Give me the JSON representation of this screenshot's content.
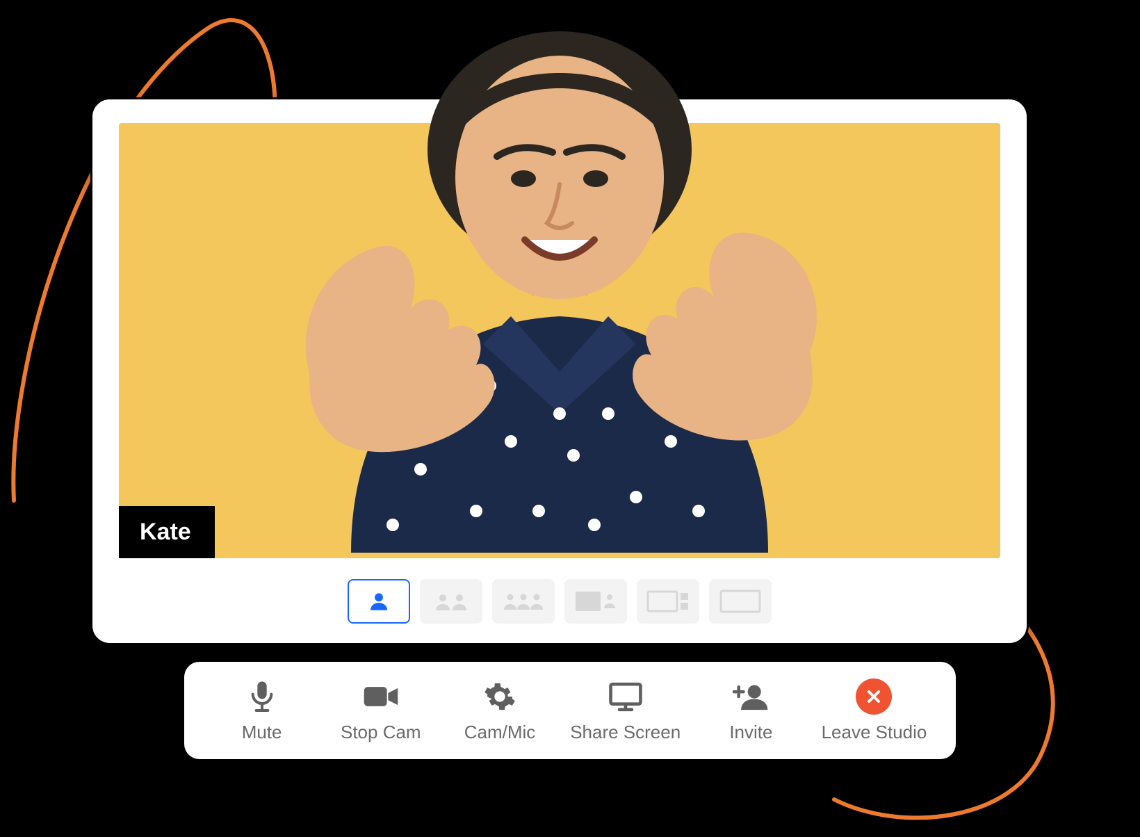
{
  "participant": {
    "name": "Kate"
  },
  "layouts": {
    "active_index": 0,
    "options": [
      {
        "name": "single"
      },
      {
        "name": "two-up"
      },
      {
        "name": "three-up"
      },
      {
        "name": "spotlight-right"
      },
      {
        "name": "spotlight-left"
      },
      {
        "name": "fullscreen"
      }
    ]
  },
  "toolbar": {
    "mute": {
      "label": "Mute",
      "icon": "microphone-icon"
    },
    "stop_cam": {
      "label": "Stop Cam",
      "icon": "video-icon"
    },
    "cam_mic": {
      "label": "Cam/Mic",
      "icon": "gear-icon"
    },
    "share": {
      "label": "Share Screen",
      "icon": "monitor-icon"
    },
    "invite": {
      "label": "Invite",
      "icon": "add-user-icon"
    },
    "leave": {
      "label": "Leave Studio",
      "icon": "close-icon",
      "color": "#ef5331"
    }
  },
  "colors": {
    "accent": "#1767ff",
    "video_bg": "#f3c75b",
    "swirl": "#ee7a2d",
    "danger": "#ef5331"
  }
}
